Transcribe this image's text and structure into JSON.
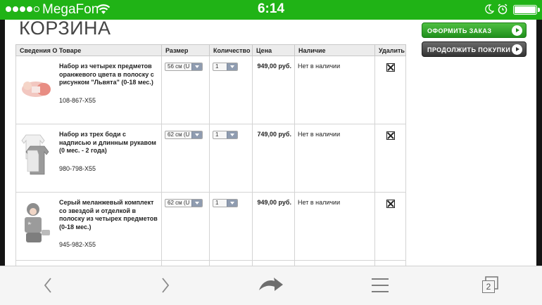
{
  "status_bar": {
    "carrier": "MegaFon",
    "time": "6:14",
    "signal_bars_filled": 4,
    "signal_bars_total": 5
  },
  "page": {
    "title": "КОРЗИНА"
  },
  "table": {
    "headers": {
      "info": "Сведения О Товаре",
      "size": "Размер",
      "qty": "Количество",
      "price": "Цена",
      "stock": "Наличие",
      "delete": "Удалить"
    },
    "rows": [
      {
        "name": "Набор из четырех предметов оранжевого цвета в полоску с рисунком \"Львята\" (0-18 мес.)",
        "sku": "108-867-X55",
        "size": "56 см (U",
        "qty": "1",
        "price": "949,00 руб.",
        "stock": "Нет в наличии"
      },
      {
        "name": "Набор из трех боди с надписью и длинным рукавом (0 мес. - 2 года)",
        "sku": "980-798-X55",
        "size": "62 см (U",
        "qty": "1",
        "price": "749,00 руб.",
        "stock": "Нет в наличии"
      },
      {
        "name": "Серый меланжевый комплект со звездой и отделкой в полоску из четырех предметов (0-18 мес.)",
        "sku": "945-982-X55",
        "size": "62 см (U",
        "qty": "1",
        "price": "949,00 руб.",
        "stock": "Нет в наличии"
      }
    ]
  },
  "buttons": {
    "order": "ОФОРМИТЬ ЗАКАЗ",
    "continue": "ПРОДОЛЖИТЬ ПОКУПКИ"
  },
  "toolbar": {
    "tabs_count": "2",
    "icons": [
      "back-icon",
      "forward-icon",
      "share-icon",
      "menu-icon",
      "tabs-icon"
    ]
  },
  "colors": {
    "status_bar": "#20b316",
    "order_button": "#2fa52a",
    "continue_button": "#4a4a4a"
  }
}
